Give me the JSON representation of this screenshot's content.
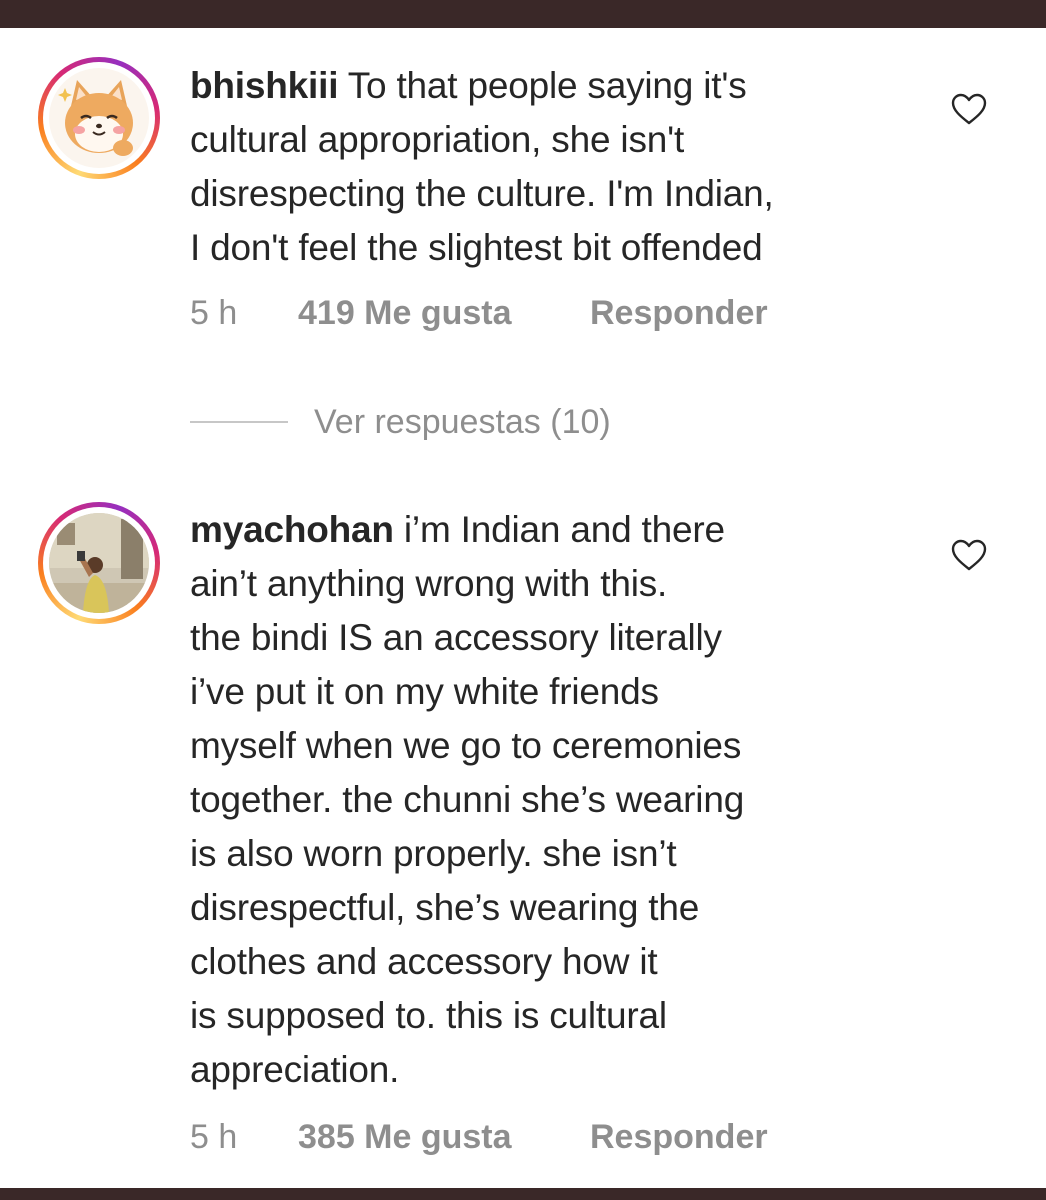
{
  "comments": [
    {
      "username": "bhishkiii",
      "lines": [
        " To that people saying it's",
        "cultural appropriation, she isn't",
        "disrespecting the culture. I'm Indian,",
        "I don't feel the slightest bit offended"
      ],
      "time": "5 h",
      "likes": "419 Me gusta",
      "reply": "Responder",
      "avatar_icon": "shiba-dog-cartoon"
    },
    {
      "username": "myachohan",
      "lines": [
        " i’m Indian and there",
        "ain’t anything wrong with this.",
        "the bindi IS an accessory literally",
        "i’ve put it on my white friends",
        "myself when we go to ceremonies",
        "together. the chunni she’s wearing",
        "is also worn properly. she isn’t",
        "disrespectful, she’s wearing the",
        "clothes and accessory how it",
        "is supposed to. this is cultural",
        "appreciation."
      ],
      "time": "5 h",
      "likes": "385 Me gusta",
      "reply": "Responder",
      "avatar_icon": "mirror-selfie-photo"
    }
  ],
  "view_replies": "Ver respuestas (10)",
  "colors": {
    "frame": "#3a2828",
    "text": "#262626",
    "meta": "#8e8e8e",
    "ring_start": "#feda75",
    "ring_mid": "#d62976",
    "ring_end": "#962fbf"
  }
}
